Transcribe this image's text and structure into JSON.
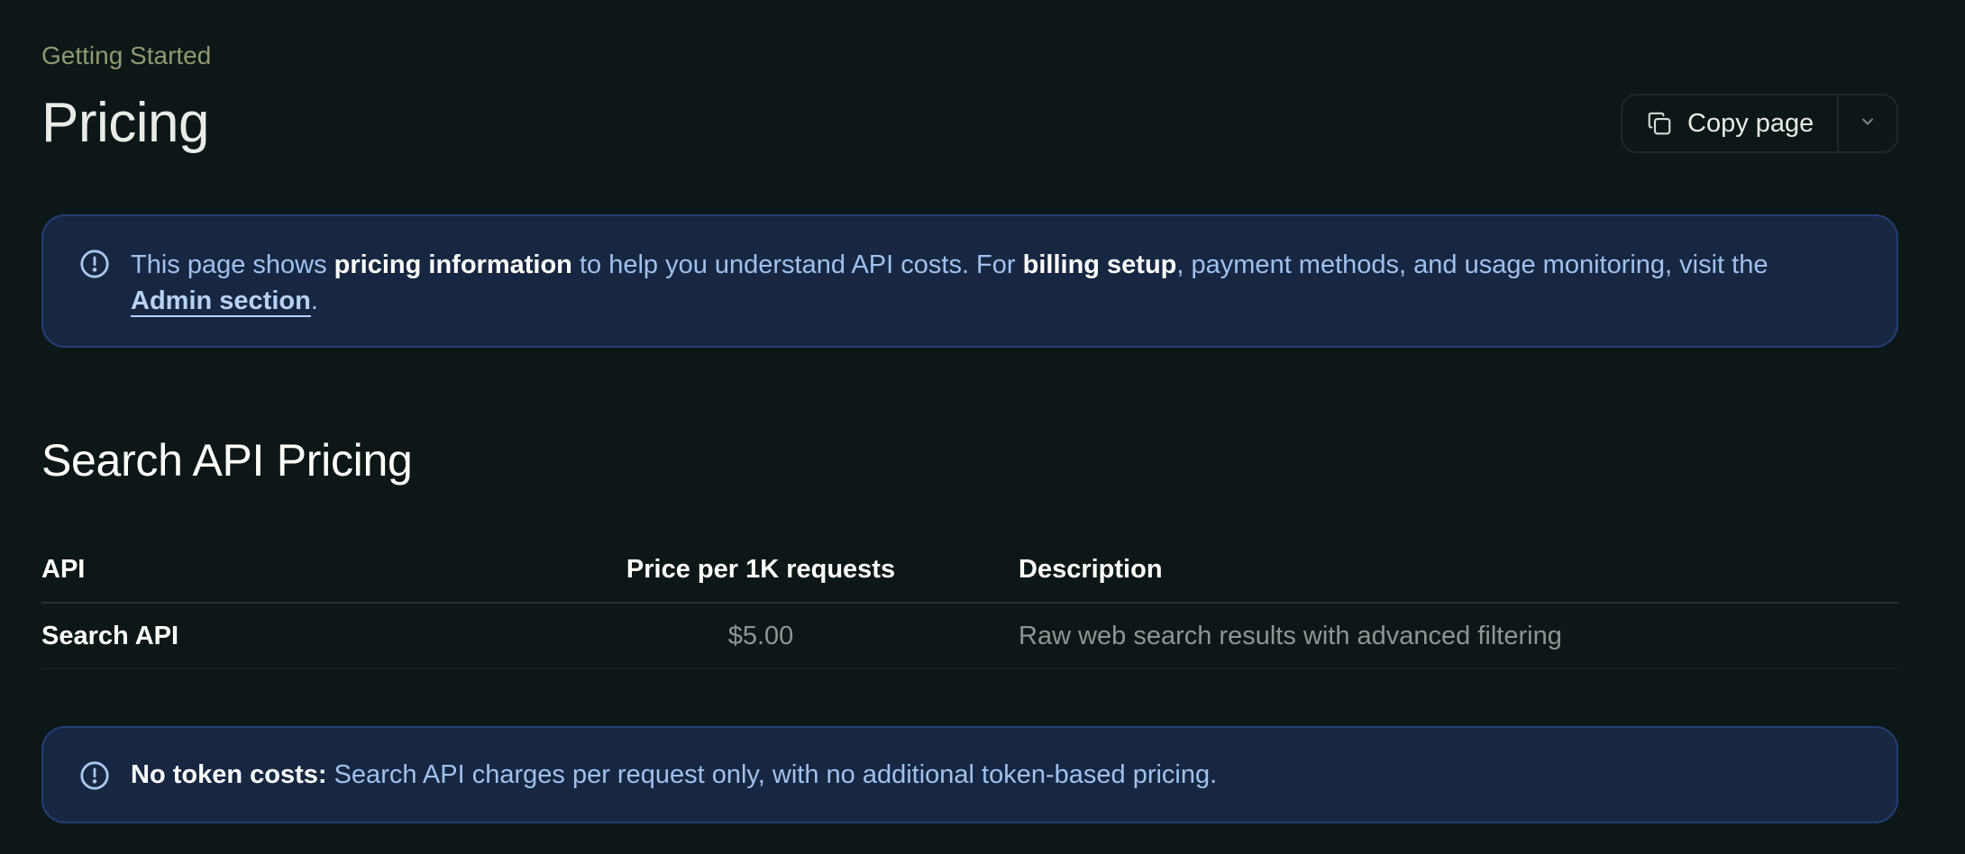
{
  "breadcrumb": "Getting Started",
  "page_title": "Pricing",
  "copy_page": {
    "label": "Copy page"
  },
  "callout_billing": {
    "text_1": "This page shows ",
    "bold_1": "pricing information",
    "text_2": " to help you understand API costs. For ",
    "bold_2": "billing setup",
    "text_3": ", payment methods, and usage monitoring, visit the ",
    "link": "Admin section",
    "text_4": "."
  },
  "section_title": "Search API Pricing",
  "pricing_table": {
    "headers": [
      "API",
      "Price per 1K requests",
      "Description"
    ],
    "rows": [
      {
        "api": "Search API",
        "price": "$5.00",
        "description": "Raw web search results with advanced filtering"
      }
    ]
  },
  "callout_tokens": {
    "bold": "No token costs:",
    "text": " Search API charges per request only, with no additional token-based pricing."
  },
  "icons": {
    "copy": "copy-icon",
    "dropdown": "chevron-down-icon",
    "info": "info-circle-icon"
  },
  "colors": {
    "background": "#0d1717",
    "callout_bg": "#172742",
    "callout_border": "#233f77",
    "callout_text": "#9fc1ef",
    "eyebrow": "#8f9a72"
  }
}
